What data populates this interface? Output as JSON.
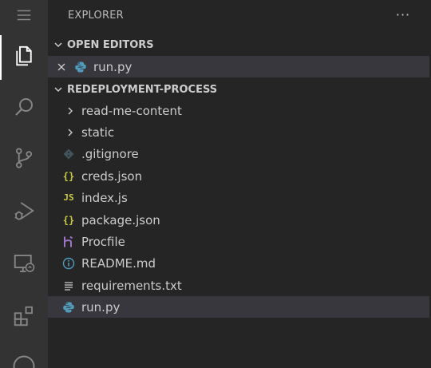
{
  "activity_bar": {
    "items": [
      {
        "name": "menu",
        "icon": "hamburger-menu-icon"
      },
      {
        "name": "explorer",
        "icon": "files-icon",
        "active": true
      },
      {
        "name": "search",
        "icon": "search-icon"
      },
      {
        "name": "source-control",
        "icon": "source-control-icon"
      },
      {
        "name": "run-debug",
        "icon": "run-debug-icon"
      },
      {
        "name": "remote-explorer",
        "icon": "remote-explorer-icon"
      },
      {
        "name": "extensions",
        "icon": "extensions-icon"
      },
      {
        "name": "github",
        "icon": "github-icon"
      }
    ]
  },
  "sidebar": {
    "title": "EXPLORER",
    "more_actions": "···",
    "open_editors": {
      "header": "OPEN EDITORS",
      "items": [
        {
          "label": "run.py",
          "icon": "python-icon"
        }
      ]
    },
    "folder": {
      "header": "REDEPLOYMENT-PROCESS",
      "items": [
        {
          "label": "read-me-content",
          "type": "folder"
        },
        {
          "label": "static",
          "type": "folder"
        },
        {
          "label": ".gitignore",
          "icon": "git-icon"
        },
        {
          "label": "creds.json",
          "icon": "json-braces-icon",
          "icon_text": "{}"
        },
        {
          "label": "index.js",
          "icon": "javascript-icon",
          "icon_text": "JS"
        },
        {
          "label": "package.json",
          "icon": "json-braces-icon",
          "icon_text": "{}"
        },
        {
          "label": "Procfile",
          "icon": "heroku-icon"
        },
        {
          "label": "README.md",
          "icon": "info-icon"
        },
        {
          "label": "requirements.txt",
          "icon": "text-lines-icon"
        },
        {
          "label": "run.py",
          "icon": "python-icon",
          "selected": true
        }
      ]
    }
  },
  "colors": {
    "activity_bar_bg": "#333333",
    "sidebar_bg": "#252526",
    "selected_row_bg": "#37373d",
    "json_icon": "#cbcb41",
    "js_icon": "#cbcb41",
    "python_blue": "#519aba",
    "git_icon": "#41535b",
    "heroku_icon": "#a074c4",
    "info_icon": "#519aba"
  }
}
